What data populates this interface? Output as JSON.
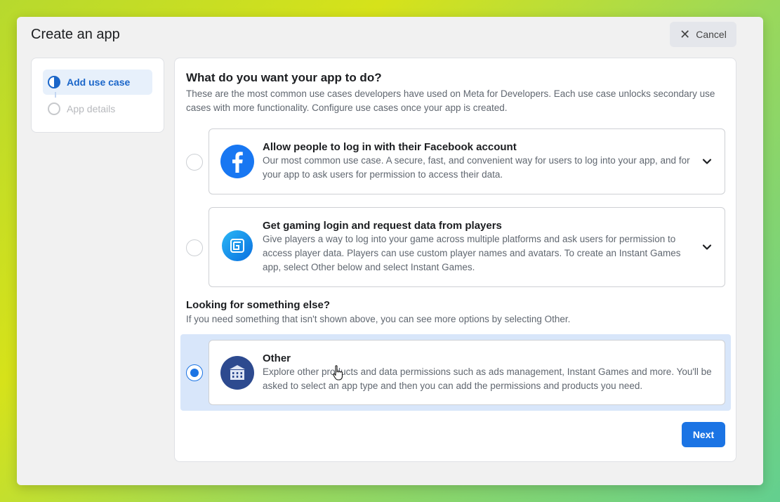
{
  "dialog": {
    "title": "Create an app",
    "cancel_label": "Cancel"
  },
  "steps": [
    {
      "label": "Add use case",
      "state": "active"
    },
    {
      "label": "App details",
      "state": "inactive"
    }
  ],
  "main": {
    "question_title": "What do you want your app to do?",
    "question_desc": "These are the most common use cases developers have used on Meta for Developers. Each use case unlocks secondary use cases with more functionality. Configure use cases once your app is created.",
    "options": [
      {
        "title": "Allow people to log in with their Facebook account",
        "description": "Our most common use case. A secure, fast, and convenient way for users to log into your app, and for your app to ask users for permission to access their data.",
        "icon": "facebook-logo-icon",
        "selected": false
      },
      {
        "title": "Get gaming login and request data from players",
        "description": "Give players a way to log into your game across multiple platforms and ask users for permission to access player data. Players can use custom player names and avatars. To create an Instant Games app, select Other below and select Instant Games.",
        "icon": "gaming-icon",
        "selected": false
      }
    ],
    "else_title": "Looking for something else?",
    "else_desc": "If you need something that isn't shown above, you can see more options by selecting Other.",
    "other": {
      "title": "Other",
      "description": "Explore other products and data permissions such as ads management, Instant Games and more. You'll be asked to select an app type and then you can add the permissions and products you need.",
      "icon": "building-icon",
      "selected": true
    },
    "next_label": "Next"
  },
  "colors": {
    "accent": "#1b74e4",
    "selected_band": "#d8e6fa",
    "facebook_blue": "#1877f2"
  }
}
